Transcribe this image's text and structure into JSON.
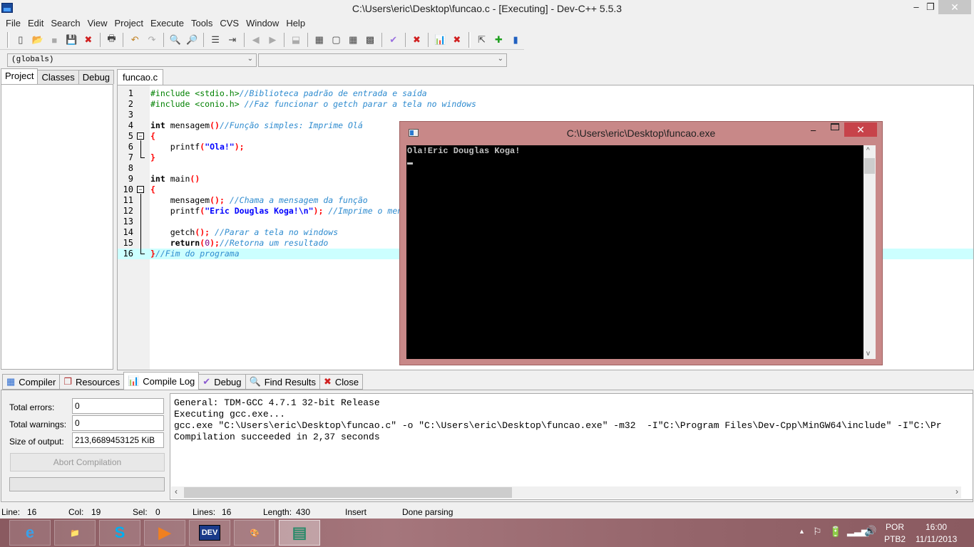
{
  "window": {
    "title": "C:\\Users\\eric\\Desktop\\funcao.c - [Executing] - Dev-C++ 5.5.3",
    "minimize_glyph": "‒",
    "maximize_glyph": "❐",
    "close_glyph": "✕"
  },
  "menu": [
    "File",
    "Edit",
    "Search",
    "View",
    "Project",
    "Execute",
    "Tools",
    "CVS",
    "Window",
    "Help"
  ],
  "toolbar": {
    "buttons": [
      {
        "name": "new-file-icon",
        "glyph": "▯"
      },
      {
        "name": "open-file-icon",
        "glyph": "📂"
      },
      {
        "name": "save-icon",
        "glyph": "■"
      },
      {
        "name": "save-all-icon",
        "glyph": "💾"
      },
      {
        "name": "close-file-icon",
        "glyph": "✖"
      },
      {
        "name": "print-icon",
        "glyph": "🖶"
      },
      {
        "name": "undo-icon",
        "glyph": "↶"
      },
      {
        "name": "redo-icon",
        "glyph": "↷"
      },
      {
        "name": "find-icon",
        "glyph": "🔍"
      },
      {
        "name": "replace-icon",
        "glyph": "🔎"
      },
      {
        "name": "indent-icon",
        "glyph": "☰"
      },
      {
        "name": "unindent-icon",
        "glyph": "⇥"
      },
      {
        "name": "bookmark-prev-icon",
        "glyph": "◀"
      },
      {
        "name": "bookmark-next-icon",
        "glyph": "▶"
      },
      {
        "name": "goto-icon",
        "glyph": "⬓"
      },
      {
        "name": "new-project-icon",
        "glyph": "▦"
      },
      {
        "name": "window-icon",
        "glyph": "▢"
      },
      {
        "name": "colors-icon",
        "glyph": "▦"
      },
      {
        "name": "grid-icon",
        "glyph": "▩"
      },
      {
        "name": "check-syntax-icon",
        "glyph": "✔"
      },
      {
        "name": "stop-icon",
        "glyph": "✖"
      },
      {
        "name": "profile-icon",
        "glyph": "📊"
      },
      {
        "name": "delete-profile-icon",
        "glyph": "✖"
      },
      {
        "name": "debug-step-icon",
        "glyph": "⇱"
      },
      {
        "name": "add-icon",
        "glyph": "✚"
      },
      {
        "name": "book-icon",
        "glyph": "▮"
      }
    ]
  },
  "combos": {
    "scope": "(globals)",
    "function": ""
  },
  "left_tabs": [
    "Project",
    "Classes",
    "Debug"
  ],
  "editor": {
    "tab": "funcao.c",
    "lines": [
      {
        "n": "1",
        "parts": [
          [
            "pre",
            "#include <stdio.h>"
          ],
          [
            "cm",
            "//Biblioteca padrão de entrada e saída"
          ]
        ]
      },
      {
        "n": "2",
        "parts": [
          [
            "pre",
            "#include <conio.h> "
          ],
          [
            "cm",
            "//Faz funcionar o getch parar a tela no windows"
          ]
        ]
      },
      {
        "n": "3",
        "parts": []
      },
      {
        "n": "4",
        "parts": [
          [
            "kw",
            "int"
          ],
          [
            "tx",
            " mensagem"
          ],
          [
            "sym",
            "()"
          ],
          [
            "cm",
            "//Função simples: Imprime Olá"
          ]
        ]
      },
      {
        "n": "5",
        "parts": [
          [
            "sym",
            "{"
          ]
        ]
      },
      {
        "n": "6",
        "parts": [
          [
            "tx",
            "    printf"
          ],
          [
            "sym",
            "("
          ],
          [
            "str",
            "\"Ola!\""
          ],
          [
            "sym",
            ");"
          ]
        ]
      },
      {
        "n": "7",
        "parts": [
          [
            "sym",
            "}"
          ]
        ]
      },
      {
        "n": "8",
        "parts": []
      },
      {
        "n": "9",
        "parts": [
          [
            "kw",
            "int"
          ],
          [
            "tx",
            " main"
          ],
          [
            "sym",
            "()"
          ]
        ]
      },
      {
        "n": "10",
        "parts": [
          [
            "sym",
            "{"
          ]
        ]
      },
      {
        "n": "11",
        "parts": [
          [
            "tx",
            "    mensagem"
          ],
          [
            "sym",
            "();"
          ],
          [
            "tx",
            " "
          ],
          [
            "cm",
            "//Chama a mensagem da função"
          ]
        ]
      },
      {
        "n": "12",
        "parts": [
          [
            "tx",
            "    printf"
          ],
          [
            "sym",
            "("
          ],
          [
            "str",
            "\"Eric Douglas Koga!\\n\""
          ],
          [
            "sym",
            ");"
          ],
          [
            "tx",
            " "
          ],
          [
            "cm",
            "//Imprime o mensagem"
          ]
        ]
      },
      {
        "n": "13",
        "parts": []
      },
      {
        "n": "14",
        "parts": [
          [
            "tx",
            "    getch"
          ],
          [
            "sym",
            "();"
          ],
          [
            "tx",
            " "
          ],
          [
            "cm",
            "//Parar a tela no windows"
          ]
        ]
      },
      {
        "n": "15",
        "parts": [
          [
            "kw",
            "    return"
          ],
          [
            "sym",
            "("
          ],
          [
            "num",
            "0"
          ],
          [
            "sym",
            ");"
          ],
          [
            "cm",
            "//Retorna um resultado"
          ]
        ]
      },
      {
        "n": "16",
        "parts": [
          [
            "sym",
            "}"
          ],
          [
            "cm",
            "//Fim do programa"
          ]
        ]
      }
    ],
    "highlighted_line": 16
  },
  "console": {
    "title": "C:\\Users\\eric\\Desktop\\funcao.exe",
    "output": "Ola!Eric Douglas Koga!",
    "minimize_glyph": "‒",
    "close_glyph": "✕"
  },
  "bottom_tabs": [
    {
      "label": "Compiler",
      "icon": "compiler-icon",
      "glyph": "▦",
      "color": "#2a6ad0"
    },
    {
      "label": "Resources",
      "icon": "resources-icon",
      "glyph": "❐",
      "color": "#b03030"
    },
    {
      "label": "Compile Log",
      "icon": "compile-log-icon",
      "glyph": "📊",
      "color": "#c08000"
    },
    {
      "label": "Debug",
      "icon": "debug-icon",
      "glyph": "✔",
      "color": "#8a5ad0"
    },
    {
      "label": "Find Results",
      "icon": "find-results-icon",
      "glyph": "🔍",
      "color": "#2a6ad0"
    },
    {
      "label": "Close",
      "icon": "close-icon",
      "glyph": "✖",
      "color": "#d02020"
    }
  ],
  "compile_stats": {
    "errors_label": "Total errors:",
    "errors": "0",
    "warnings_label": "Total warnings:",
    "warnings": "0",
    "size_label": "Size of output:",
    "size": "213,6689453125 KiB",
    "abort_label": "Abort Compilation"
  },
  "compile_log": [
    "General: TDM-GCC 4.7.1 32-bit Release",
    "Executing gcc.exe...",
    "gcc.exe \"C:\\Users\\eric\\Desktop\\funcao.c\" -o \"C:\\Users\\eric\\Desktop\\funcao.exe\" -m32  -I\"C:\\Program Files\\Dev-Cpp\\MinGW64\\include\" -I\"C:\\Pr",
    "Compilation succeeded in 2,37 seconds"
  ],
  "status": {
    "line_label": "Line:",
    "line": "16",
    "col_label": "Col:",
    "col": "19",
    "sel_label": "Sel:",
    "sel": "0",
    "lines_label": "Lines:",
    "lines": "16",
    "length_label": "Length:",
    "length": "430",
    "mode": "Insert",
    "message": "Done parsing"
  },
  "taskbar": {
    "apps": [
      {
        "name": "internet-explorer-icon",
        "glyph": "e",
        "color": "#3aa0e8"
      },
      {
        "name": "file-explorer-icon",
        "glyph": "📁",
        "color": "#f0c040"
      },
      {
        "name": "skype-icon",
        "glyph": "S",
        "color": "#00aff0"
      },
      {
        "name": "media-player-icon",
        "glyph": "▶",
        "color": "#f08020"
      },
      {
        "name": "devcpp-icon",
        "glyph": "DEV",
        "color": "#1a3a8a"
      },
      {
        "name": "paint-icon",
        "glyph": "🎨",
        "color": "#e0a060"
      },
      {
        "name": "console-window-icon",
        "glyph": "▤",
        "color": "#2a8a6a"
      }
    ],
    "language": "POR",
    "keyboard": "PTB2",
    "time": "16:00",
    "date": "11/11/2013"
  }
}
